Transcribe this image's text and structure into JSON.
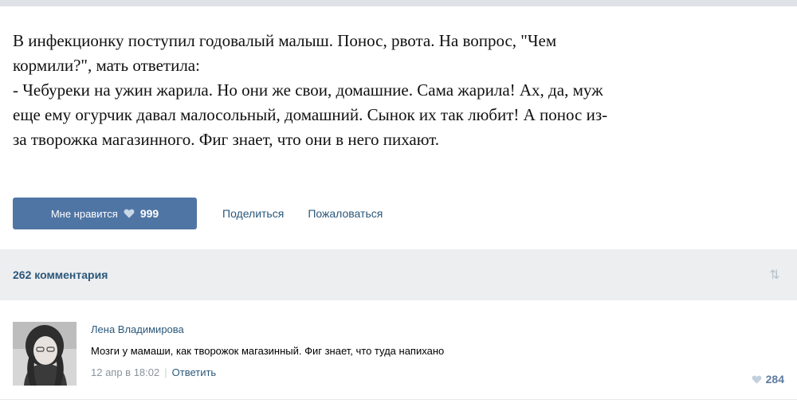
{
  "post": {
    "lines": [
      "В инфекционку поступил годовалый малыш. Понос, рвота. На вопрос, \"Чем",
      "кормили?\", мать ответила:",
      "- Чебуреки на ужин жарила. Но они же свои, домашние. Сама жарила! Ах, да, муж",
      "еще ему огурчик давал малосольный, домашний. Сынок их так любит! А понос из-",
      "за творожка магазинного. Фиг знает, что они в него пихают."
    ]
  },
  "actions": {
    "like_label": "Мне нравится",
    "like_count": "999",
    "share_label": "Поделиться",
    "report_label": "Пожаловаться"
  },
  "comments": {
    "count_label": "262 комментария",
    "items": [
      {
        "author": "Лена Владимирова",
        "text": "Мозги у мамаши, как творожок магазинный. Фиг знает, что туда напихано",
        "date": "12 апр в 18:02",
        "reply_label": "Ответить",
        "likes": "284"
      }
    ]
  },
  "colors": {
    "like_button": "#4f75a4",
    "link": "#2b587a",
    "bar_bg": "#edeef0"
  }
}
